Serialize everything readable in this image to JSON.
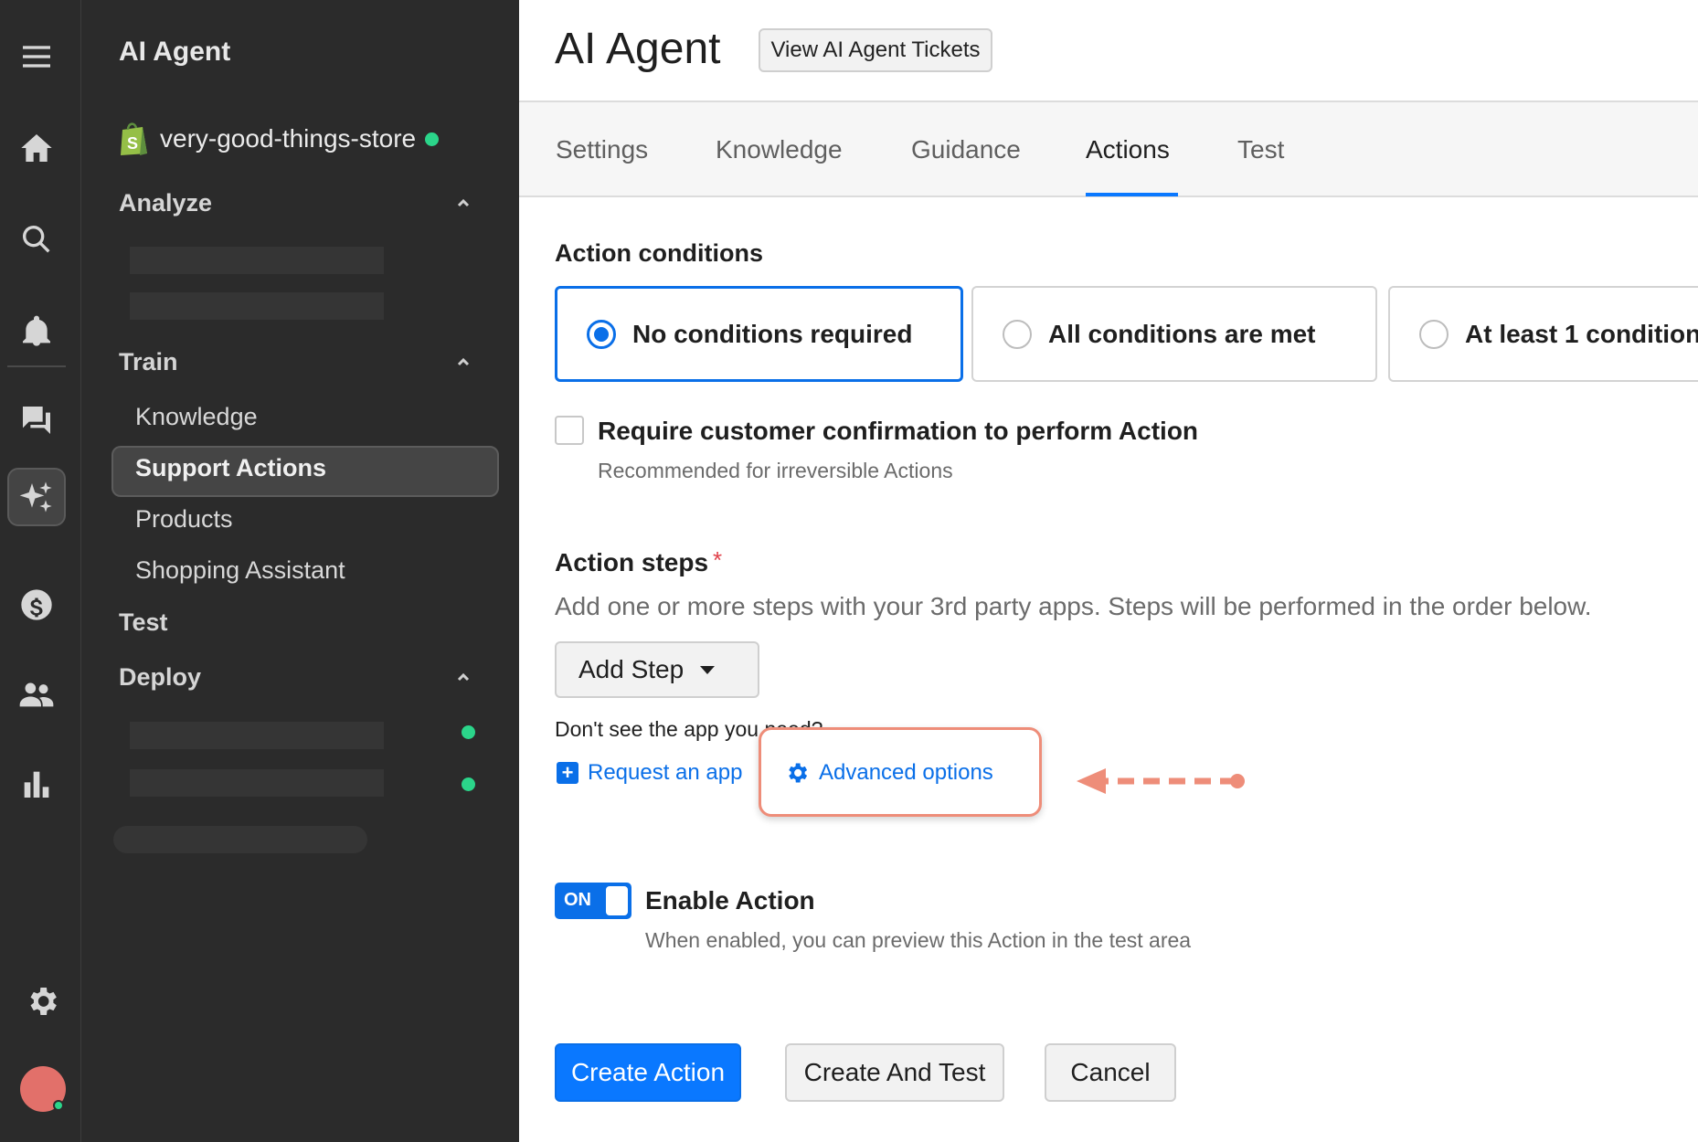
{
  "sidebar": {
    "title": "AI Agent",
    "store_name": "very-good-things-store",
    "sections": {
      "analyze": "Analyze",
      "train": "Train",
      "test": "Test",
      "deploy": "Deploy"
    },
    "train_items": [
      "Knowledge",
      "Support Actions",
      "Products",
      "Shopping Assistant"
    ],
    "active_item": "Support Actions"
  },
  "header": {
    "title": "AI Agent",
    "tickets_button": "View AI Agent Tickets"
  },
  "tabs": [
    "Settings",
    "Knowledge",
    "Guidance",
    "Actions",
    "Test"
  ],
  "active_tab": "Actions",
  "action_conditions": {
    "label": "Action conditions",
    "options": [
      "No conditions required",
      "All conditions are met",
      "At least 1 condition"
    ],
    "selected": "No conditions required"
  },
  "confirmation": {
    "label": "Require customer confirmation to perform Action",
    "help": "Recommended for irreversible Actions",
    "checked": false
  },
  "action_steps": {
    "label": "Action steps",
    "required_mark": "*",
    "description": "Add one or more steps with your 3rd party apps. Steps will be performed in the order below.",
    "add_step": "Add Step",
    "dont_see": "Don't see the app you need?",
    "request_app": "Request an app",
    "advanced_options": "Advanced options"
  },
  "enable": {
    "toggle_text": "ON",
    "label": "Enable Action",
    "help": "When enabled, you can preview this Action in the test area",
    "on": true
  },
  "footer": {
    "create": "Create Action",
    "create_test": "Create And Test",
    "cancel": "Cancel"
  },
  "colors": {
    "accent": "#0a78ff",
    "sidebar_bg": "#2b2b2b",
    "status_green": "#2bd58a",
    "annotation": "#ee8d79",
    "required": "#e0414a"
  },
  "icons": {
    "rail": [
      "menu-icon",
      "home-icon",
      "search-icon",
      "bell-icon",
      "chat-icon",
      "ai-sparkle-icon",
      "dollar-icon",
      "users-icon",
      "bar-chart-icon",
      "gear-icon"
    ]
  }
}
